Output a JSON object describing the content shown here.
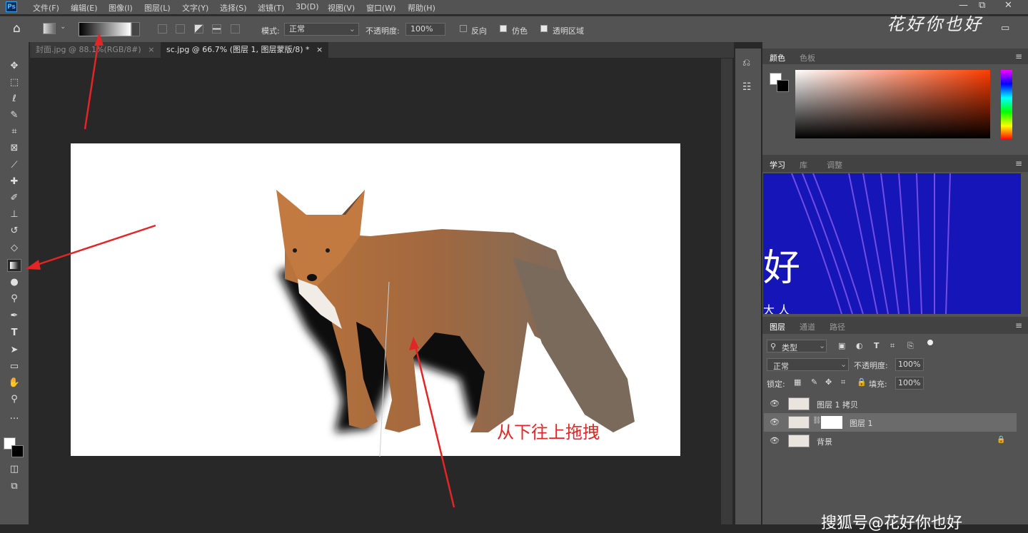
{
  "menubar": {
    "logo": "Ps",
    "items": [
      "文件(F)",
      "编辑(E)",
      "图像(I)",
      "图层(L)",
      "文字(Y)",
      "选择(S)",
      "滤镜(T)",
      "3D(D)",
      "视图(V)",
      "窗口(W)",
      "帮助(H)"
    ],
    "controls": [
      "—",
      "⧉",
      "✕"
    ]
  },
  "options": {
    "mode_label": "模式:",
    "mode_value": "正常",
    "opacity_label": "不透明度:",
    "opacity_value": "100%",
    "reverse_label": "反向",
    "dither_label": "仿色",
    "transparency_label": "透明区域"
  },
  "tabs": [
    {
      "label": "封面.jpg @ 88.1%(RGB/8#)",
      "close": "×"
    },
    {
      "label": "sc.jpg @ 66.7% (图层 1, 图层蒙版/8) *",
      "close": "×"
    }
  ],
  "panels": {
    "color_tabs": [
      "颜色",
      "色板"
    ],
    "learn_tabs": [
      "学习",
      "库",
      "调整"
    ],
    "learn_text": "好",
    "learn_subtext": "大 人",
    "layer_tabs": [
      "图层",
      "通道",
      "路径"
    ],
    "kind_label": "类型",
    "blend_mode": "正常",
    "opacity_label": "不透明度:",
    "opacity_value": "100%",
    "lock_label": "锁定:",
    "fill_label": "填充:",
    "fill_value": "100%"
  },
  "layers": [
    {
      "name": "图层 1 拷贝",
      "selected": false
    },
    {
      "name": "图层 1",
      "selected": true
    },
    {
      "name": "背景",
      "selected": false,
      "locked": true
    }
  ],
  "annotations": {
    "hint": "从下往上拖拽",
    "watermark_top": "花好你也好",
    "watermark_bottom": "搜狐号@花好你也好"
  },
  "colors": {
    "accent_arrow": "#e32525",
    "panel_bg": "#535353",
    "workspace_bg": "#282828"
  }
}
